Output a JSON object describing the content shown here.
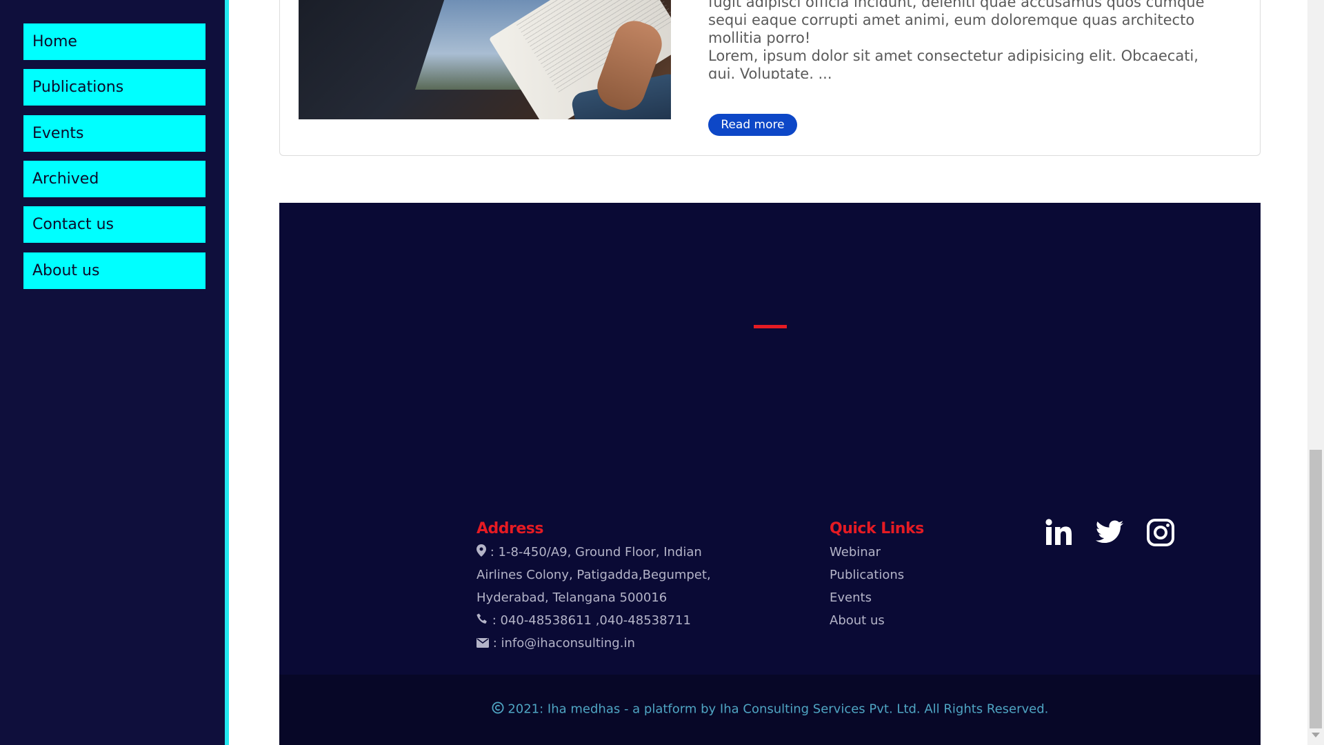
{
  "sidebar": {
    "items": [
      {
        "label": "Home"
      },
      {
        "label": "Publications"
      },
      {
        "label": "Events"
      },
      {
        "label": "Archived"
      },
      {
        "label": "Contact us"
      },
      {
        "label": "About us"
      }
    ]
  },
  "card": {
    "text_line_1": "fugit adipisci officia incidunt, deleniti quae accusamus quos cumque",
    "text_line_2": "sequi eaque corrupti amet animi, eum doloremque quas architecto",
    "text_line_3": "mollitia porro!",
    "text_line_4": "Lorem, ipsum dolor sit amet consectetur adipisicing elit. Obcaecati,",
    "text_line_5": "qui. Voluptate, ...",
    "read_more_label": "Read more"
  },
  "footer": {
    "address_title": "Address",
    "address_line_1": ": 1-8-450/A9, Ground Floor, Indian",
    "address_line_2": "Airlines Colony, Patigadda,Begumpet,",
    "address_line_3": "Hyderabad, Telangana 500016",
    "phone": ": 040-48538611 ,040-48538711",
    "email": ": info@ihaconsulting.in",
    "quick_links_title": "Quick Links",
    "quick_links": [
      "Webinar",
      "Publications",
      "Events",
      "About us"
    ],
    "social_icons": [
      "linkedin-icon",
      "twitter-icon",
      "instagram-icon"
    ],
    "copyright": "2021: Iha medhas - a platform by Iha Consulting Services Pvt. Ltd. All Rights Reserved.",
    "colors": {
      "background": "#0a0a35",
      "accent": "#e51b23",
      "copyright_text": "#4fa5c3"
    }
  }
}
